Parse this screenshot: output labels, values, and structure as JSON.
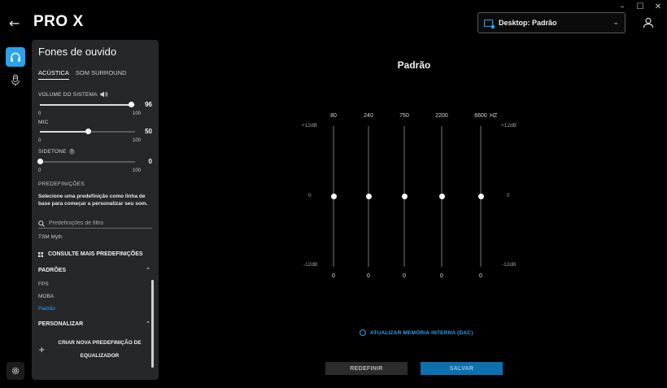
{
  "window": {
    "minimize": "–",
    "maximize": "☐",
    "close": "✕"
  },
  "header": {
    "back": "←",
    "brand": "PRO X",
    "device_profile": "Desktop: Padrão",
    "chevron": "⌄"
  },
  "panel": {
    "title": "Fones de ouvido",
    "tabs": [
      {
        "label": "ACÚSTICA",
        "active": true
      },
      {
        "label": "SOM SURROUND",
        "active": false
      }
    ],
    "system_volume": {
      "label": "VOLUME DO SISTEMA",
      "value": 96,
      "display": "96",
      "min": "0",
      "max": "100"
    },
    "mic": {
      "label": "MIC",
      "value": 50,
      "display": "50",
      "min": "0",
      "max": "100"
    },
    "sidetone": {
      "label": "SIDETONE",
      "help": "?",
      "value": 0,
      "display": "0",
      "min": "0",
      "max": "100"
    },
    "presets": {
      "heading": "PREDEFINIÇÕES",
      "description": "Selecione uma predefinição como linha de base para começar a personalizar seu som.",
      "filter_placeholder": "Predefinições de filtro",
      "partial_item": "TSM Myth",
      "more": "CONSULTE MAIS PREDEFINIÇÕES",
      "defaults_heading": "PADRÕES",
      "defaults": [
        "FPS",
        "MOBA",
        "Padrão"
      ],
      "selected": "Padrão",
      "custom_heading": "PERSONALIZAR",
      "create": "CRIAR NOVA PREDEFINIÇÃO DE EQUALIZADOR",
      "caret": "⌃"
    }
  },
  "equalizer": {
    "title": "Padrão",
    "hz_label": "HZ",
    "db_top": "+12dB",
    "db_mid": "0",
    "db_bottom": "-12dB",
    "bands": [
      {
        "freq": "80",
        "gain": 0,
        "display": "0"
      },
      {
        "freq": "240",
        "gain": 0,
        "display": "0"
      },
      {
        "freq": "750",
        "gain": 0,
        "display": "0"
      },
      {
        "freq": "2200",
        "gain": 0,
        "display": "0"
      },
      {
        "freq": "6600",
        "gain": 0,
        "display": "0"
      }
    ],
    "gain_range": [
      -12,
      12
    ],
    "update_firmware": "ATUALIZAR MEMÓRIA INTERNA (DAC)",
    "reset": "REDEFINIR",
    "save": "SALVAR"
  },
  "colors": {
    "accent": "#2aa2f1",
    "panel": "#262729",
    "background": "#000000"
  }
}
